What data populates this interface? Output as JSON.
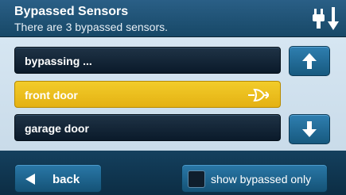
{
  "header": {
    "title": "Bypassed Sensors",
    "subtitle": "There are 3 bypassed sensors.",
    "status_icon": "plug-unplug-icon"
  },
  "list": {
    "items": [
      {
        "label": "bypassing ...",
        "selected": false
      },
      {
        "label": "front door",
        "selected": true,
        "icon": "bypass-gate-icon"
      },
      {
        "label": "garage door",
        "selected": false
      }
    ],
    "scroll_up_icon": "arrow-up-icon",
    "scroll_down_icon": "arrow-down-icon"
  },
  "footer": {
    "back_label": "back",
    "back_icon": "triangle-left-icon",
    "show_bypassed_label": "show bypassed only",
    "show_bypassed_checked": false
  },
  "colors": {
    "header_bg": "#1e5276",
    "main_bg": "#d1e3f0",
    "row_dark": "#0f2233",
    "row_selected": "#eec023",
    "button_blue": "#2070a0"
  }
}
